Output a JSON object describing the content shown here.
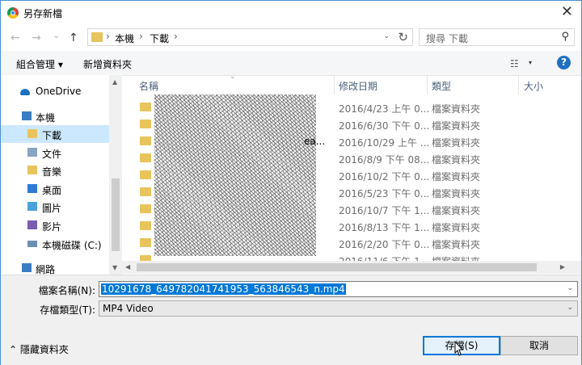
{
  "window": {
    "title": "另存新檔",
    "close": "✕"
  },
  "nav": {
    "back": "←",
    "forward": "→",
    "history": "⌄",
    "up": "↑"
  },
  "address": {
    "crumbs": [
      "本機",
      "下載"
    ],
    "sep": "›",
    "dropdown": "⌄",
    "refresh": "↻"
  },
  "search": {
    "placeholder": "搜尋 下載",
    "icon": "⚲"
  },
  "toolbar": {
    "organize": "組合管理 ▾",
    "new_folder": "新增資料夾",
    "view": "☷",
    "view_dd": "▾",
    "help": "?"
  },
  "sidebar": {
    "items": [
      {
        "label": "OneDrive",
        "icon": "cloud-icon",
        "color": "#1f6fc5"
      },
      {
        "label": "本機",
        "icon": "computer-icon",
        "color": "#3b7dc4"
      },
      {
        "label": "下載",
        "icon": "download-folder-icon",
        "color": "#e8c45c",
        "selected": true
      },
      {
        "label": "文件",
        "icon": "document-folder-icon",
        "color": "#8aa4c3"
      },
      {
        "label": "音樂",
        "icon": "music-folder-icon",
        "color": "#e8c45c"
      },
      {
        "label": "桌面",
        "icon": "desktop-folder-icon",
        "color": "#2f7bd4"
      },
      {
        "label": "圖片",
        "icon": "picture-folder-icon",
        "color": "#4aa2d8"
      },
      {
        "label": "影片",
        "icon": "video-folder-icon",
        "color": "#7a5fb0"
      },
      {
        "label": "本機磁碟 (C:)",
        "icon": "drive-icon",
        "color": "#6d8fb5"
      },
      {
        "label": "網路",
        "icon": "network-icon",
        "color": "#3b7dc4"
      }
    ]
  },
  "columns": {
    "name": "名稱",
    "date": "修改日期",
    "type": "類型",
    "size": "大小"
  },
  "files": [
    {
      "date": "2016/4/23 上午 0...",
      "type": "檔案資料夾"
    },
    {
      "date": "2016/6/30 下午 0...",
      "type": "檔案資料夾"
    },
    {
      "date": "2016/10/29 上午 ...",
      "type": "檔案資料夾",
      "name_fragment": "ea..."
    },
    {
      "date": "2016/8/9 下午 08...",
      "type": "檔案資料夾"
    },
    {
      "date": "2016/10/2 下午 0...",
      "type": "檔案資料夾"
    },
    {
      "date": "2016/5/23 下午 0...",
      "type": "檔案資料夾"
    },
    {
      "date": "2016/10/7 下午 1...",
      "type": "檔案資料夾"
    },
    {
      "date": "2016/8/13 下午 1...",
      "type": "檔案資料夾"
    },
    {
      "date": "2016/2/20 下午 0...",
      "type": "檔案資料夾"
    },
    {
      "date": "2016/11/6 下午 1...",
      "type": "檔案資料夾"
    }
  ],
  "form": {
    "filename_label": "檔案名稱(N):",
    "filename_value": "10291678_649782041741953_563846543_n.mp4",
    "filetype_label": "存檔類型(T):",
    "filetype_value": "MP4 Video",
    "dropdown": "⌄"
  },
  "footer": {
    "hide_folders": "⌃  隱藏資料夾",
    "save": "存檔(S)",
    "cancel": "取消"
  },
  "colors": {
    "accent": "#0078d7",
    "selection": "#cce8ff",
    "folder": "#e8c45c"
  }
}
